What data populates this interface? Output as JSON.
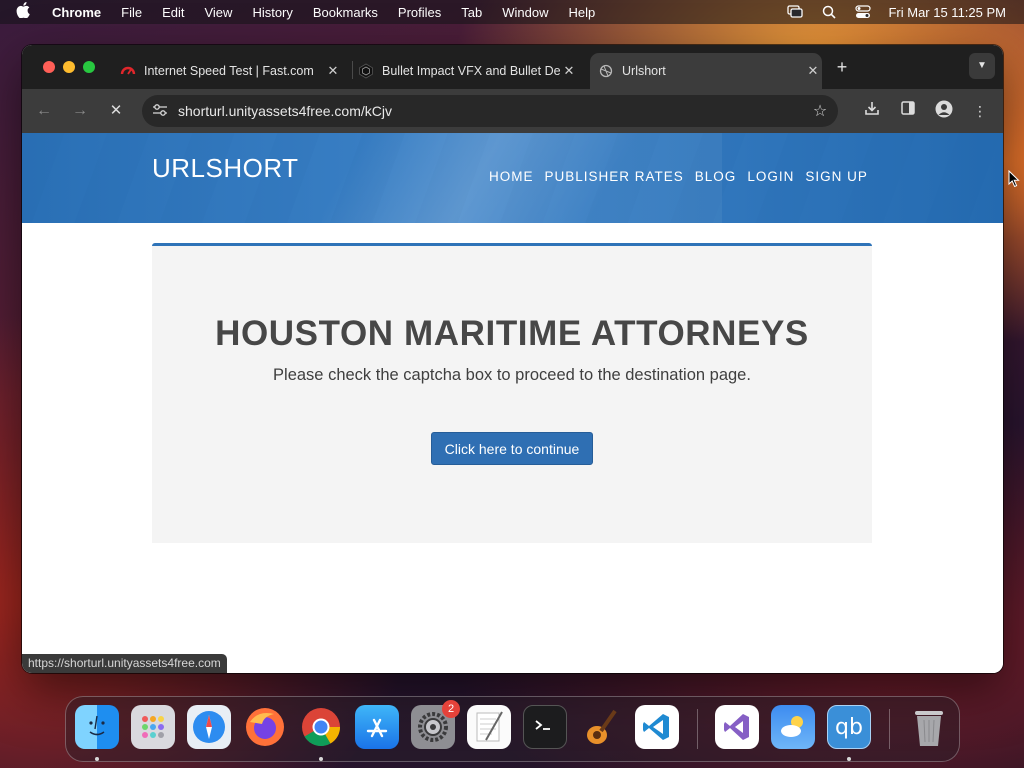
{
  "menubar": {
    "app_name": "Chrome",
    "menus": [
      "File",
      "Edit",
      "View",
      "History",
      "Bookmarks",
      "Profiles",
      "Tab",
      "Window",
      "Help"
    ],
    "clock": "Fri Mar 15  11:25 PM"
  },
  "browser": {
    "tabs": [
      {
        "title": "Internet Speed Test | Fast.com",
        "icon": "fast-com-icon"
      },
      {
        "title": "Bullet Impact VFX and Bullet Decals",
        "icon": "unity-icon"
      },
      {
        "title": "Urlshort",
        "icon": "globe-icon",
        "active": true
      }
    ],
    "url": "shorturl.unityassets4free.com/kCjv",
    "status_url": "https://shorturl.unityassets4free.com"
  },
  "site": {
    "logo": "URLSHORT",
    "nav": [
      "HOME",
      "PUBLISHER RATES",
      "BLOG",
      "LOGIN",
      "SIGN UP"
    ],
    "heading": "HOUSTON MARITIME ATTORNEYS",
    "message": "Please check the captcha box to proceed to the destination page.",
    "continue_label": "Click here to continue"
  },
  "dock": {
    "apps": [
      {
        "name": "finder-icon"
      },
      {
        "name": "launchpad-icon"
      },
      {
        "name": "safari-icon"
      },
      {
        "name": "firefox-icon"
      },
      {
        "name": "chrome-icon"
      },
      {
        "name": "app-store-icon"
      },
      {
        "name": "system-settings-icon",
        "badge": "2"
      },
      {
        "name": "textedit-icon"
      },
      {
        "name": "terminal-icon"
      },
      {
        "name": "garageband-icon"
      },
      {
        "name": "vscode-icon"
      },
      {
        "name": "visual-studio-icon"
      },
      {
        "name": "weather-icon"
      },
      {
        "name": "qbittorrent-icon",
        "label": "qb"
      },
      {
        "name": "trash-icon"
      }
    ]
  },
  "colors": {
    "accent": "#2f6fb3",
    "header_blue": "#2e73b8",
    "badge_red": "#e5423a"
  }
}
